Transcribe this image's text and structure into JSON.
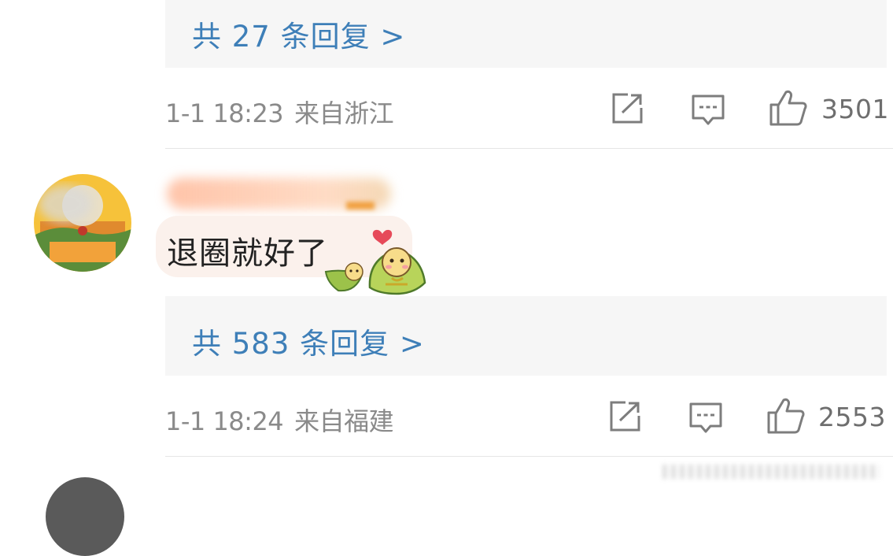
{
  "comments": [
    {
      "replies_link": "共 27 条回复 >",
      "time": "1-1 18:23",
      "location": "来自浙江",
      "likes": "3501"
    },
    {
      "username": "",
      "text": "退圈就好了",
      "replies_link": "共 583 条回复 >",
      "time": "1-1 18:24",
      "location": "来自福建",
      "likes": "2553"
    }
  ],
  "icons": {
    "share": "share-icon",
    "comment": "comment-icon",
    "like": "thumbs-up-icon",
    "sticker": "zongzi-heart-sticker"
  },
  "colors": {
    "link": "#3e7fb8",
    "meta": "#8a8a8a",
    "reply_bg": "#f6f6f6",
    "bubble_bg": "#fbf1ec"
  }
}
